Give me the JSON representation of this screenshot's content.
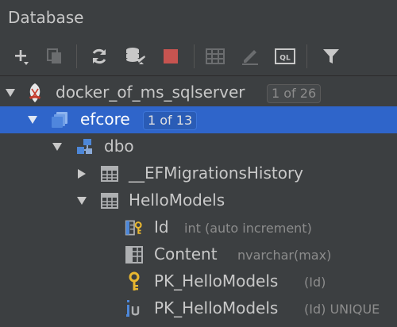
{
  "panel": {
    "title": "Database"
  },
  "toolbar": {
    "icons": [
      "add-icon",
      "duplicate-icon",
      "refresh-icon",
      "schema-sync-icon",
      "stop-icon",
      "table-view-icon",
      "edit-icon",
      "ql-console-icon",
      "filter-icon"
    ],
    "ql_label": "QL",
    "colors": {
      "stop": "#c75450",
      "icon": "#aeb0b2",
      "disabled": "#6b6d6f"
    }
  },
  "tree": {
    "datasource": {
      "label": "docker_of_ms_sqlserver",
      "badge": "1 of 26"
    },
    "database": {
      "label": "efcore",
      "badge": "1 of 13"
    },
    "schema": {
      "label": "dbo"
    },
    "tables": [
      {
        "label": "__EFMigrationsHistory",
        "expanded": false
      },
      {
        "label": "HelloModels",
        "expanded": true
      }
    ],
    "columns": [
      {
        "name": "Id",
        "type": "int (auto increment)"
      },
      {
        "name": "Content",
        "type": "nvarchar(max)"
      }
    ],
    "keys": [
      {
        "name": "PK_HelloModels",
        "detail": "(Id)"
      }
    ],
    "indexes": [
      {
        "name": "PK_HelloModels",
        "detail": "(Id) UNIQUE"
      }
    ],
    "colors": {
      "selection": "#2f65ca",
      "key": "#e8b730",
      "table": "#aeb0b2",
      "schema": "#4d87d8"
    }
  }
}
